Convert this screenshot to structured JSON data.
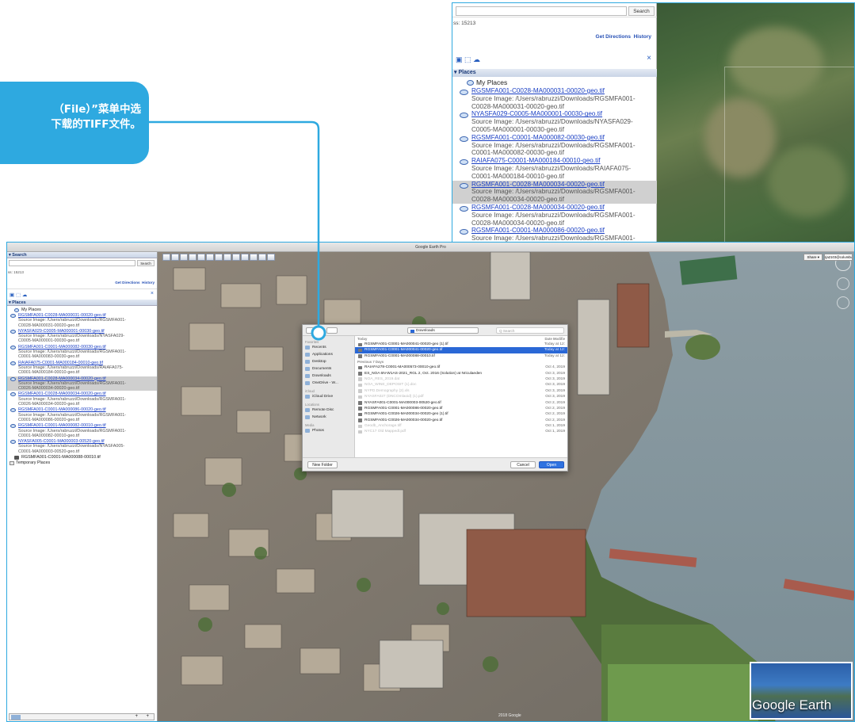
{
  "callout": {
    "line1": "（File）”菜单中选",
    "line2": "下载的TIFF文件。",
    "color": "#2ea9e0"
  },
  "inset": {
    "search_button": "Search",
    "coords": "ss: 15213",
    "get_directions": "Get Directions",
    "history": "History",
    "places_header": "▾ Places",
    "my_places": "My Places",
    "items": [
      {
        "name": "RGSMFA001-C0028-MA000031-00020-geo.tif",
        "src1": "Source Image: /Users/rabruzzi/Downloads/RGSMFA001-",
        "src2": "C0028-MA000031-00020-geo.tif"
      },
      {
        "name": "NYASFA029-C0005-MA000001-00030-geo.tif",
        "src1": "Source Image: /Users/rabruzzi/Downloads/NYASFA029-",
        "src2": "C0005-MA000001-00030-geo.tif"
      },
      {
        "name": "RGSMFA001-C0001-MA000082-00030-geo.tif",
        "src1": "Source Image: /Users/rabruzzi/Downloads/RGSMFA001-",
        "src2": "C0001-MA000082-00030-geo.tif"
      },
      {
        "name": "RAIAFA075-C0001-MA000184-00010-geo.tif",
        "src1": "Source Image: /Users/rabruzzi/Downloads/RAIAFA075-",
        "src2": "C0001-MA000184-00010-geo.tif"
      },
      {
        "name": "RGSMFA001-C0028-MA000034-00020-geo.tif",
        "src1": "Source Image: /Users/rabruzzi/Downloads/RGSMFA001-",
        "src2": "C0028-MA000034-00020-geo.tif"
      },
      {
        "name": "RGSMFA001-C0028-MA000034-00020-geo.tif",
        "src1": "Source Image: /Users/rabruzzi/Downloads/RGSMFA001-",
        "src2": "C0028-MA000034-00020-geo.tif"
      },
      {
        "name": "RGSMFA001-C0001-MA000086-00020-geo.tif",
        "src1": "Source Image: /Users/rabruzzi/Downloads/RGSMFA001-",
        "src2": "C0001-MA000086-00020-geo.tif"
      }
    ]
  },
  "window": {
    "title": "Google Earth Pro",
    "share": "Share ▾",
    "account": "rja2103@columbia.edu",
    "search_header": "▾ Search",
    "search_button": "Search",
    "coords": "ss: 15213",
    "get_directions": "Get Directions",
    "history": "History",
    "places_header": "▾ Places",
    "my_places": "My Places",
    "places": [
      {
        "name": "RGSMFA001-C0028-MA000031-00020-geo.tif",
        "src1": "Source Image: /Users/rabruzzi/Downloads/RGSMFA001-",
        "src2": "C0028-MA000031-00020-geo.tif"
      },
      {
        "name": "NYASFA029-C0005-MA000001-00030-geo.tif",
        "src1": "Source Image: /Users/rabruzzi/Downloads/NYASFA029-",
        "src2": "C0005-MA000001-00030-geo.tif"
      },
      {
        "name": "RGSMFA001-C0001-MA000082-00030-geo.tif",
        "src1": "Source Image: /Users/rabruzzi/Downloads/RGSMFA001-",
        "src2": "C0001-MA000083-00030-geo.tif"
      },
      {
        "name": "RAIAFA075-C0001-MA000184-00010-geo.tif",
        "src1": "Source Image: /Users/rabruzzi/Downloads/RAIAFA075-",
        "src2": "C0001-MA000184-00010-geo.tif"
      },
      {
        "name": "RGSMFA001-C0028-MA000034-00020-geo.tif",
        "src1": "Source Image: /Users/rabruzzi/Downloads/RGSMFA001-",
        "src2": "C0026-MA000034-00020-geo.tif"
      },
      {
        "name": "RGSMFA001-C0028-MA000034-00020-geo.tif",
        "src1": "Source Image: /Users/rabruzzi/Downloads/RGSMFA001-",
        "src2": "C0026-MA000034-00020-geo.tif"
      },
      {
        "name": "RGSMFA001-C0001-MA000086-00020-geo.tif",
        "src1": "Source Image: /Users/rabruzzi/Downloads/RGSMFA001-",
        "src2": "C0001-MA000086-00020-geo.tif"
      },
      {
        "name": "RGSMFA001-C0001-MA000082-00010-geo.tif",
        "src1": "Source Image: /Users/rabruzzi/Downloads/RGSMFA001-",
        "src2": "C0001-MA000082-00010-geo.tif"
      },
      {
        "name": "NYASFA005-C0001-MA000003-00520-geo.tif",
        "src1": "Source Image: /Users/rabruzzi/Downloads/NYASFA005-",
        "src2": "C0001-MA000003-00520-geo.tif"
      }
    ],
    "extra_place": "RGSMFA001-C0001-MA000088-00010.tif",
    "temporary_places": "Temporary Places",
    "copyright": "2018 Google",
    "logo_text": "Google Earth"
  },
  "dialog": {
    "location": "Downloads",
    "search_placeholder": "Q Search",
    "col_name": "Today",
    "col_date": "Date Modifie",
    "sidebar": {
      "favorites": "Favorites",
      "fav_items": [
        "Recents",
        "Applications",
        "Desktop",
        "Documents",
        "Downloads",
        "OneDrive - W..."
      ],
      "icloud": "iCloud",
      "icloud_items": [
        "iCloud Drive"
      ],
      "locations": "Locations",
      "loc_items": [
        "Remote Disc",
        "Network"
      ],
      "media": "Media",
      "media_items": [
        "Photos"
      ]
    },
    "today": [
      {
        "name": "RGSMFA001-C0001-MA000041-00020-geo (1).tif",
        "date": "Today at 12:"
      },
      {
        "name": "RGSMFA001-C0001-MA000041-00020-geo.tif",
        "date": "Today at 12:",
        "selected": true
      },
      {
        "name": "RGSMFA001-C0001-MA000088-00010.tif",
        "date": "Today at 12:"
      }
    ],
    "prev_label": "Previous 7 Days",
    "previous": [
      {
        "name": "RAIAFA278-C0001-MA000573-00010-geo.tif",
        "date": "Oct 4, 2019"
      },
      {
        "name": "ES_NOA 6N-W1AS-2021_RGL 2, Oct. 2016 (Solution) at Nriculaeden",
        "date": "Oct 3, 2019"
      },
      {
        "name": "NOA_RES_2019.dat",
        "date": "Oct 3, 2019",
        "dim": true
      },
      {
        "name": "NOA_WINE_DEPOSIT (1).doc",
        "date": "Oct 3, 2019",
        "dim": true
      },
      {
        "name": "NYPD.Demography (2).xls",
        "date": "Oct 3, 2019",
        "dim": true
      },
      {
        "name": "NYASFA027 (DNCOmlaoid) (1).pdf",
        "date": "Oct 3, 2019",
        "dim": true
      },
      {
        "name": "NYASFA001-C0001-MA000003-00520-geo.tif",
        "date": "Oct 2, 2019"
      },
      {
        "name": "RGSMFA001-C0001-MA000086-00020-geo.tif",
        "date": "Oct 2, 2019"
      },
      {
        "name": "RGSMFA001-C0026-MA000034-00020-geo (1).tif",
        "date": "Oct 2, 2019"
      },
      {
        "name": "RGSMFA001-C0026-MA000034-00020-geo.tif",
        "date": "Oct 2, 2019"
      },
      {
        "name": "Geodb_Anchorage.tiff",
        "date": "Oct 1, 2019",
        "dim": true
      },
      {
        "name": "NYC17 Old Mappedl.pdf",
        "date": "Oct 1, 2019",
        "dim": true
      }
    ],
    "new_folder": "New Folder",
    "cancel": "Cancel",
    "open": "Open"
  }
}
